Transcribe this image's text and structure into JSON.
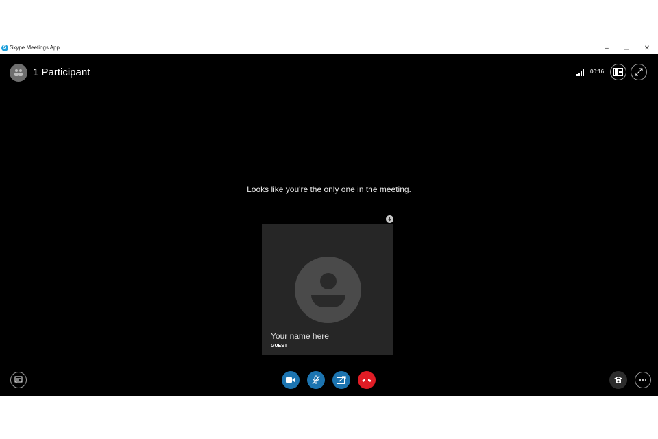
{
  "window": {
    "title": "Skype Meetings App",
    "app_icon_glyph": "S",
    "minimize_glyph": "–",
    "maximize_glyph": "❐",
    "close_glyph": "✕"
  },
  "header": {
    "participants_label": "1 Participant",
    "call_timer": "00:16",
    "icons": [
      "participants-icon",
      "signal-strength-icon",
      "content-view-icon",
      "fullscreen-icon"
    ]
  },
  "main": {
    "message": "Looks like you're the only one in the meeting.",
    "self_tile": {
      "name": "Your name here",
      "role": "GUEST"
    }
  },
  "controls": {
    "icons": [
      "chat-icon",
      "video-camera-icon",
      "microphone-muted-icon",
      "share-screen-icon",
      "hang-up-icon",
      "dialpad-phone-icon",
      "more-options-icon"
    ]
  },
  "colors": {
    "background": "#000000",
    "accent_blue": "#1c74b0",
    "hangup_red": "#e01c25",
    "tile_bg": "#262626"
  }
}
